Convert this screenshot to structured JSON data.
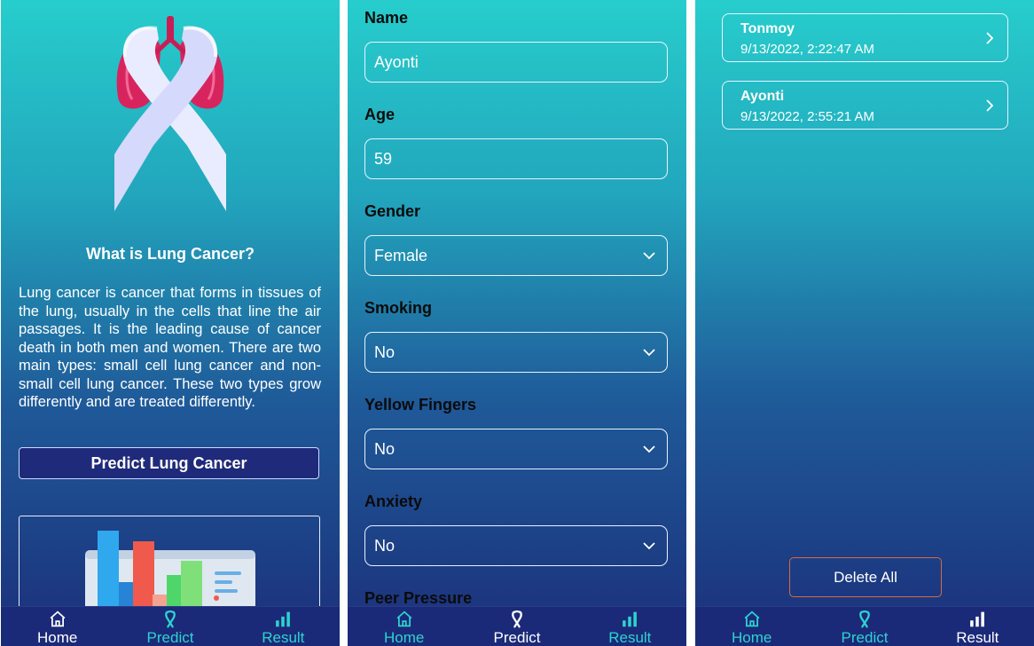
{
  "nav": {
    "home": "Home",
    "predict": "Predict",
    "result": "Result"
  },
  "home": {
    "heading": "What is Lung Cancer?",
    "body": "Lung cancer is cancer that forms in tissues of the lung, usually in the cells that line the air passages. It is the leading cause of cancer death in both men and women. There are two main types: small cell lung cancer and non-small cell lung cancer. These two types grow differently and are treated differently.",
    "predict_button": "Predict Lung Cancer"
  },
  "form": {
    "name_label": "Name",
    "name_value": "Ayonti",
    "age_label": "Age",
    "age_value": "59",
    "gender_label": "Gender",
    "gender_value": "Female",
    "smoking_label": "Smoking",
    "smoking_value": "No",
    "yellow_fingers_label": "Yellow Fingers",
    "yellow_fingers_value": "No",
    "anxiety_label": "Anxiety",
    "anxiety_value": "No",
    "peer_pressure_label": "Peer Pressure"
  },
  "results": {
    "records": [
      {
        "name": "Tonmoy",
        "date": "9/13/2022, 2:22:47 AM"
      },
      {
        "name": "Ayonti",
        "date": "9/13/2022, 2:55:21 AM"
      }
    ],
    "delete_all": "Delete All"
  },
  "colors": {
    "teal": "#27cdcc",
    "navy": "#1b2a78",
    "accent_orange": "#d9693c",
    "nav_inactive": "#2fd3cf"
  },
  "icons": {
    "home": "house-icon",
    "predict": "ribbon-icon",
    "result": "bar-chart-icon",
    "dropdown": "chevron-down-icon",
    "record": "chevron-right-icon"
  }
}
